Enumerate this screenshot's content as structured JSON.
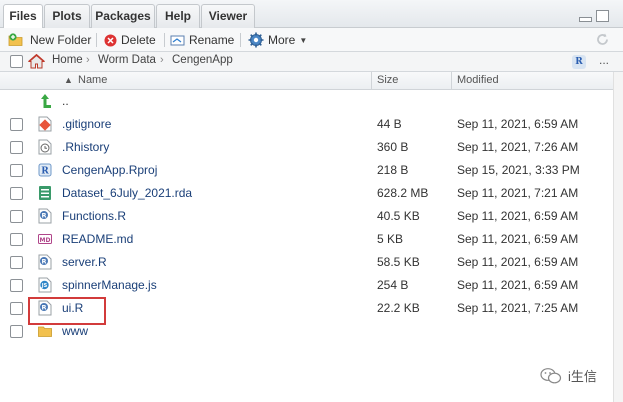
{
  "tabs": [
    {
      "label": "Files",
      "active": true
    },
    {
      "label": "Plots",
      "active": false
    },
    {
      "label": "Packages",
      "active": false
    },
    {
      "label": "Help",
      "active": false
    },
    {
      "label": "Viewer",
      "active": false
    }
  ],
  "toolbar": {
    "new_folder": "New Folder",
    "delete": "Delete",
    "rename": "Rename",
    "more": "More"
  },
  "breadcrumb": [
    "Home",
    "Worm Data",
    "CengenApp"
  ],
  "breadcrumb_sep": "›",
  "breadcrumb_more": "...",
  "r_badge": "R",
  "header": {
    "name": "Name",
    "sort": "▲",
    "size": "Size",
    "modified": "Modified"
  },
  "parent_label": "..",
  "files": [
    {
      "name": ".gitignore",
      "size": "44 B",
      "modified": "Sep 11, 2021, 6:59 AM",
      "icon": "gitignore-icon"
    },
    {
      "name": ".Rhistory",
      "size": "360 B",
      "modified": "Sep 11, 2021, 7:26 AM",
      "icon": "rhistory-icon"
    },
    {
      "name": "CengenApp.Rproj",
      "size": "218 B",
      "modified": "Sep 15, 2021, 3:33 PM",
      "icon": "rproj-icon"
    },
    {
      "name": "Dataset_6July_2021.rda",
      "size": "628.2 MB",
      "modified": "Sep 11, 2021, 7:21 AM",
      "icon": "rdata-icon"
    },
    {
      "name": "Functions.R",
      "size": "40.5 KB",
      "modified": "Sep 11, 2021, 6:59 AM",
      "icon": "r-file-icon"
    },
    {
      "name": "README.md",
      "size": "5 KB",
      "modified": "Sep 11, 2021, 6:59 AM",
      "icon": "markdown-icon"
    },
    {
      "name": "server.R",
      "size": "58.5 KB",
      "modified": "Sep 11, 2021, 6:59 AM",
      "icon": "r-file-icon"
    },
    {
      "name": "spinnerManage.js",
      "size": "254 B",
      "modified": "Sep 11, 2021, 6:59 AM",
      "icon": "js-file-icon"
    },
    {
      "name": "ui.R",
      "size": "22.2 KB",
      "modified": "Sep 11, 2021, 7:25 AM",
      "icon": "r-file-icon"
    },
    {
      "name": "www",
      "size": "",
      "modified": "",
      "icon": "folder-icon"
    }
  ],
  "watermark": "i生信",
  "colors": {
    "highlight": "#d23b3b",
    "link": "#1a3f78"
  }
}
